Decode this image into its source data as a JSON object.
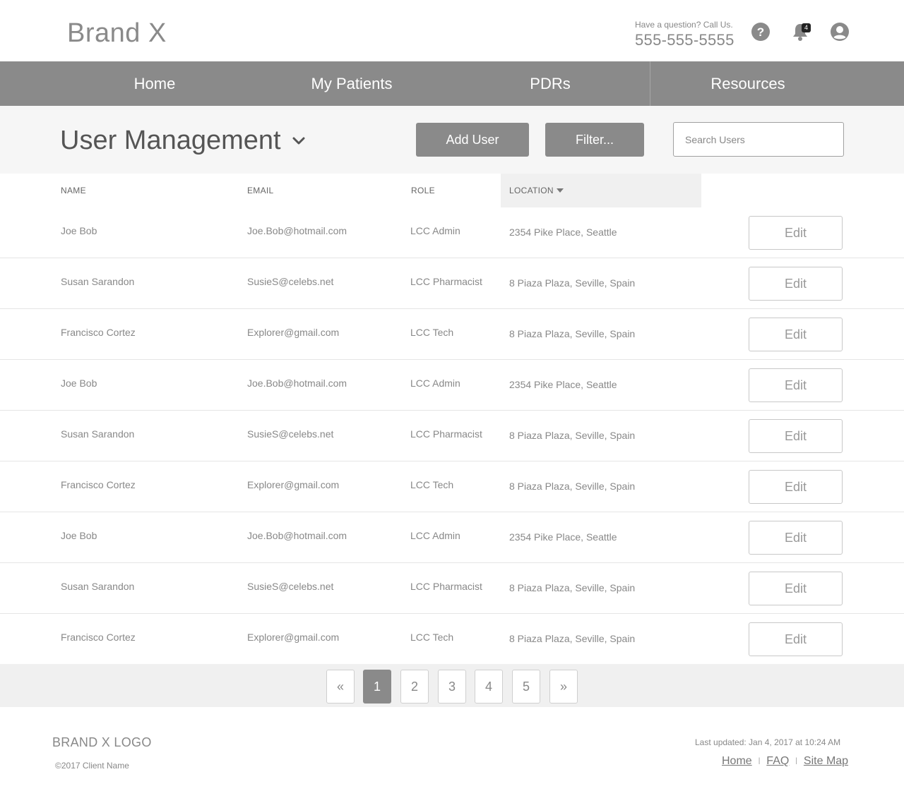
{
  "header": {
    "brand": "Brand X",
    "contact_question": "Have a question? Call Us.",
    "contact_phone": "555-555-5555",
    "notification_count": "4",
    "icons": [
      "help-icon",
      "bell-icon",
      "user-account-icon"
    ]
  },
  "nav": {
    "items": [
      {
        "label": "Home"
      },
      {
        "label": "My Patients"
      },
      {
        "label": "PDRs"
      },
      {
        "label": "Resources"
      }
    ]
  },
  "toolbar": {
    "title": "User Management",
    "add_user_label": "Add User",
    "filter_label": "Filter...",
    "search_placeholder": "Search Users"
  },
  "table": {
    "columns": [
      "NAME",
      "EMAIL",
      "ROLE",
      "LOCATION"
    ],
    "sorted_column": "LOCATION",
    "edit_label": "Edit",
    "rows": [
      {
        "name": "Joe Bob",
        "email": "Joe.Bob@hotmail.com",
        "role": "LCC Admin",
        "location": "2354 Pike Place, Seattle"
      },
      {
        "name": "Susan Sarandon",
        "email": "SusieS@celebs.net",
        "role": "LCC Pharmacist",
        "location": "8 Piaza Plaza, Seville, Spain"
      },
      {
        "name": "Francisco Cortez",
        "email": "Explorer@gmail.com",
        "role": "LCC Tech",
        "location": "8 Piaza Plaza, Seville, Spain"
      },
      {
        "name": "Joe Bob",
        "email": "Joe.Bob@hotmail.com",
        "role": "LCC Admin",
        "location": "2354 Pike Place, Seattle"
      },
      {
        "name": "Susan Sarandon",
        "email": "SusieS@celebs.net",
        "role": "LCC Pharmacist",
        "location": "8 Piaza Plaza, Seville, Spain"
      },
      {
        "name": "Francisco Cortez",
        "email": "Explorer@gmail.com",
        "role": "LCC Tech",
        "location": "8 Piaza Plaza, Seville, Spain"
      },
      {
        "name": "Joe Bob",
        "email": "Joe.Bob@hotmail.com",
        "role": "LCC Admin",
        "location": "2354 Pike Place, Seattle"
      },
      {
        "name": "Susan Sarandon",
        "email": "SusieS@celebs.net",
        "role": "LCC Pharmacist",
        "location": "8 Piaza Plaza, Seville, Spain"
      },
      {
        "name": "Francisco Cortez",
        "email": "Explorer@gmail.com",
        "role": "LCC Tech",
        "location": "8 Piaza Plaza, Seville, Spain"
      }
    ]
  },
  "pagination": {
    "prev": "«",
    "pages": [
      "1",
      "2",
      "3",
      "4",
      "5"
    ],
    "current": "1",
    "next": "»"
  },
  "footer": {
    "logo": "BRAND X LOGO",
    "copyright": "©2017 Client Name",
    "last_updated": "Last updated: Jan 4, 2017 at 10:24 AM",
    "links": [
      "Home",
      "FAQ",
      "Site Map"
    ],
    "separator": "|"
  },
  "colors": {
    "nav_bg": "#8a8a8a",
    "toolbar_bg": "#f6f6f6",
    "pager_bg": "#f0f0f0",
    "button_bg": "#8a8a8a"
  }
}
